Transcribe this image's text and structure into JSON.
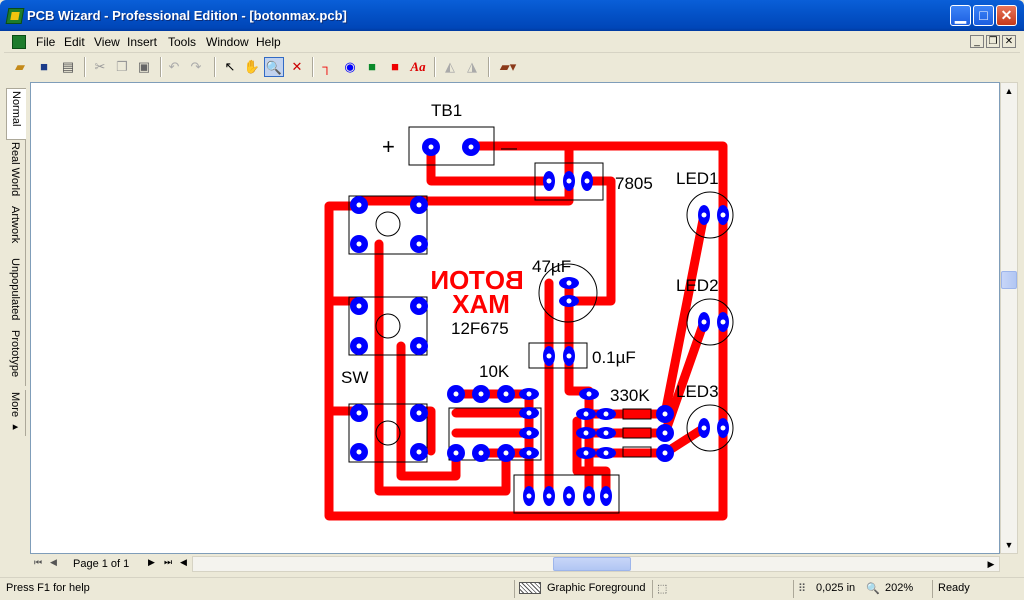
{
  "window": {
    "title": "PCB Wizard - Professional Edition - [botonmax.pcb]"
  },
  "menu": {
    "items": [
      "File",
      "Edit",
      "View",
      "Insert",
      "Tools",
      "Window",
      "Help"
    ]
  },
  "sidebar": {
    "tabs": [
      "Normal",
      "Real World",
      "Artwork",
      "Unpopulated",
      "Prototype",
      "More ▸"
    ],
    "active": "Normal"
  },
  "board": {
    "labels": {
      "tb1": "TB1",
      "reg": "7805",
      "led1": "LED1",
      "led2": "LED2",
      "led3": "LED3",
      "cap1": "47µF",
      "cap2": "0.1µF",
      "ic": "12F675",
      "r1": "10K",
      "r2": "330K",
      "sw": "SW",
      "mirrored_line1": "BOTON",
      "mirrored_line2": "MAX",
      "plus": "+",
      "minus": "—"
    },
    "colors": {
      "track": "#ff0000",
      "pad_outer": "#0000ff",
      "pad_inner": "#ffffff",
      "silk": "#000000",
      "mirrored_text": "#ff0000"
    }
  },
  "pagebar": {
    "page_text": "Page 1 of 1"
  },
  "status": {
    "help": "Press F1 for help",
    "layer": "Graphic Foreground",
    "grid": "0,025 in",
    "zoom": "202%",
    "state": "Ready"
  }
}
